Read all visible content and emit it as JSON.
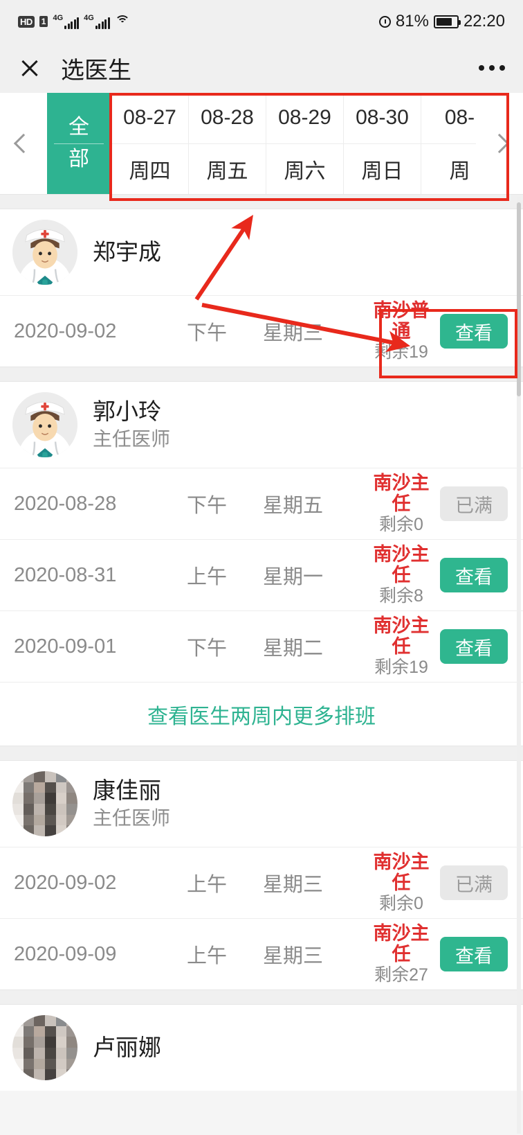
{
  "statusbar": {
    "hd_label": "HD",
    "sim_label": "1",
    "net1": "4G",
    "net2": "4G",
    "wifi_icon": "wifi-icon",
    "alarm_icon": "alarm-clock-icon",
    "battery_percent": "81%",
    "battery_icon": "battery-icon",
    "time": "22:20"
  },
  "navbar": {
    "close_icon": "close-icon",
    "title": "选医生",
    "more_icon": "more-options-icon"
  },
  "datebar": {
    "prev_icon": "chevron-left-icon",
    "next_icon": "chevron-right-icon",
    "all_tab": {
      "line1": "全",
      "line2": "部",
      "selected": true
    },
    "days": [
      {
        "date": "08-27",
        "weekday": "周四"
      },
      {
        "date": "08-28",
        "weekday": "周五"
      },
      {
        "date": "08-29",
        "weekday": "周六"
      },
      {
        "date": "08-30",
        "weekday": "周日"
      },
      {
        "date": "08-",
        "weekday": "周"
      }
    ]
  },
  "colors": {
    "accent_green": "#2eb391",
    "button_green": "#2fb68f",
    "clinic_red": "#e03030",
    "disabled_gray": "#e8e8e8",
    "annotation_red": "#e8291c"
  },
  "labels": {
    "view_button": "查看",
    "full_button": "已满",
    "more_schedule_link": "查看医生两周内更多排班"
  },
  "doctors": [
    {
      "name": "郑宇成",
      "title": "",
      "avatar": "cartoon-doctor-avatar",
      "schedules": [
        {
          "date": "2020-09-02",
          "ampm": "下午",
          "weekday": "星期三",
          "clinic": "南沙普通",
          "remaining": "剩余19",
          "action": "查看",
          "available": true
        }
      ],
      "more_link": false
    },
    {
      "name": "郭小玲",
      "title": "主任医师",
      "avatar": "cartoon-doctor-avatar",
      "schedules": [
        {
          "date": "2020-08-28",
          "ampm": "下午",
          "weekday": "星期五",
          "clinic": "南沙主任",
          "remaining": "剩余0",
          "action": "已满",
          "available": false
        },
        {
          "date": "2020-08-31",
          "ampm": "上午",
          "weekday": "星期一",
          "clinic": "南沙主任",
          "remaining": "剩余8",
          "action": "查看",
          "available": true
        },
        {
          "date": "2020-09-01",
          "ampm": "下午",
          "weekday": "星期二",
          "clinic": "南沙主任",
          "remaining": "剩余19",
          "action": "查看",
          "available": true
        }
      ],
      "more_link": true
    },
    {
      "name": "康佳丽",
      "title": "主任医师",
      "avatar": "blurred-photo-avatar",
      "schedules": [
        {
          "date": "2020-09-02",
          "ampm": "上午",
          "weekday": "星期三",
          "clinic": "南沙主任",
          "remaining": "剩余0",
          "action": "已满",
          "available": false
        },
        {
          "date": "2020-09-09",
          "ampm": "上午",
          "weekday": "星期三",
          "clinic": "南沙主任",
          "remaining": "剩余27",
          "action": "查看",
          "available": true
        }
      ],
      "more_link": false
    },
    {
      "name": "卢丽娜",
      "title": "",
      "avatar": "blurred-photo-avatar",
      "schedules": [],
      "more_link": false
    }
  ],
  "annotations": {
    "box_datebar": "highlight-date-strip",
    "box_action": "highlight-view-button-cell",
    "arrow_up": "arrow-to-date-strip",
    "arrow_down": "arrow-to-clinic-label"
  }
}
